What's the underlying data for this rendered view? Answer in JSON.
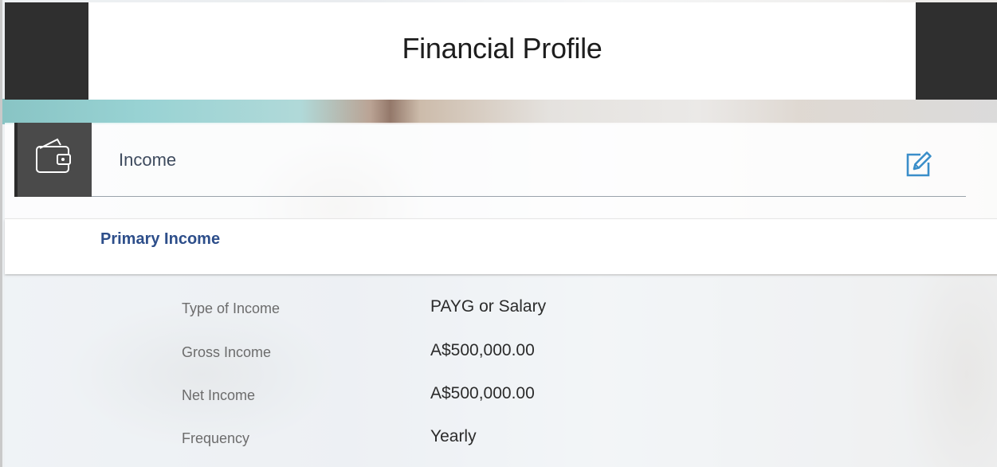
{
  "header": {
    "title": "Financial Profile"
  },
  "section": {
    "title": "Income",
    "icon": "wallet-icon",
    "edit_icon": "edit-icon"
  },
  "primary_income": {
    "title": "Primary Income",
    "rows": [
      {
        "label": "Type of Income",
        "value": "PAYG or Salary"
      },
      {
        "label": "Gross Income",
        "value": "A$500,000.00"
      },
      {
        "label": "Net Income",
        "value": "A$500,000.00"
      },
      {
        "label": "Frequency",
        "value": "Yearly"
      }
    ]
  },
  "colors": {
    "header_dark": "#2f2f2f",
    "primary_title": "#2d4e8a",
    "edit_icon": "#3a8ec9"
  }
}
